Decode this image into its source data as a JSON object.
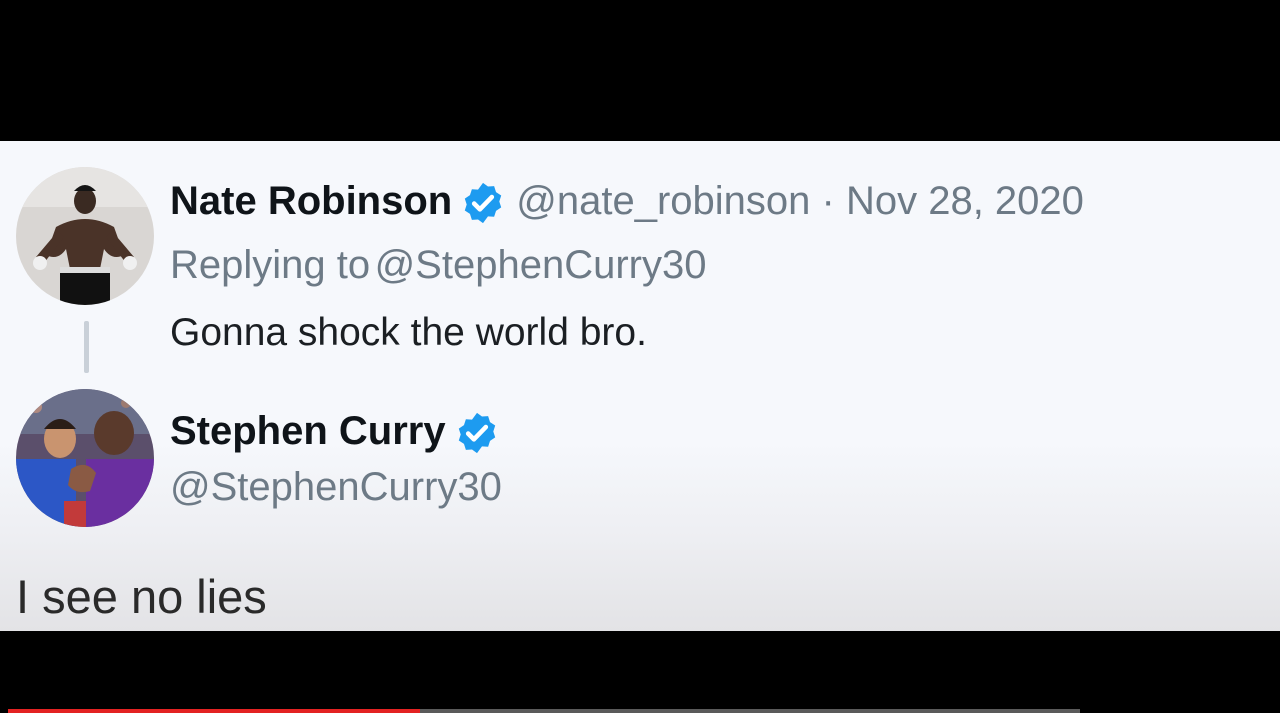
{
  "tweet": {
    "author_name": "Nate Robinson",
    "author_handle": "@nate_robinson",
    "separator": "·",
    "date": "Nov 28, 2020",
    "replying_prefix": "Replying to",
    "replying_handle": "@StephenCurry30",
    "text": "Gonna shock the world bro."
  },
  "reply_author": {
    "name": "Stephen Curry",
    "handle": "@StephenCurry30"
  },
  "reply_text": "I see no lies",
  "colors": {
    "verified_badge": "#1d9bf0",
    "progress_red": "#e32222"
  },
  "video": {
    "progress_fraction": 0.384
  }
}
